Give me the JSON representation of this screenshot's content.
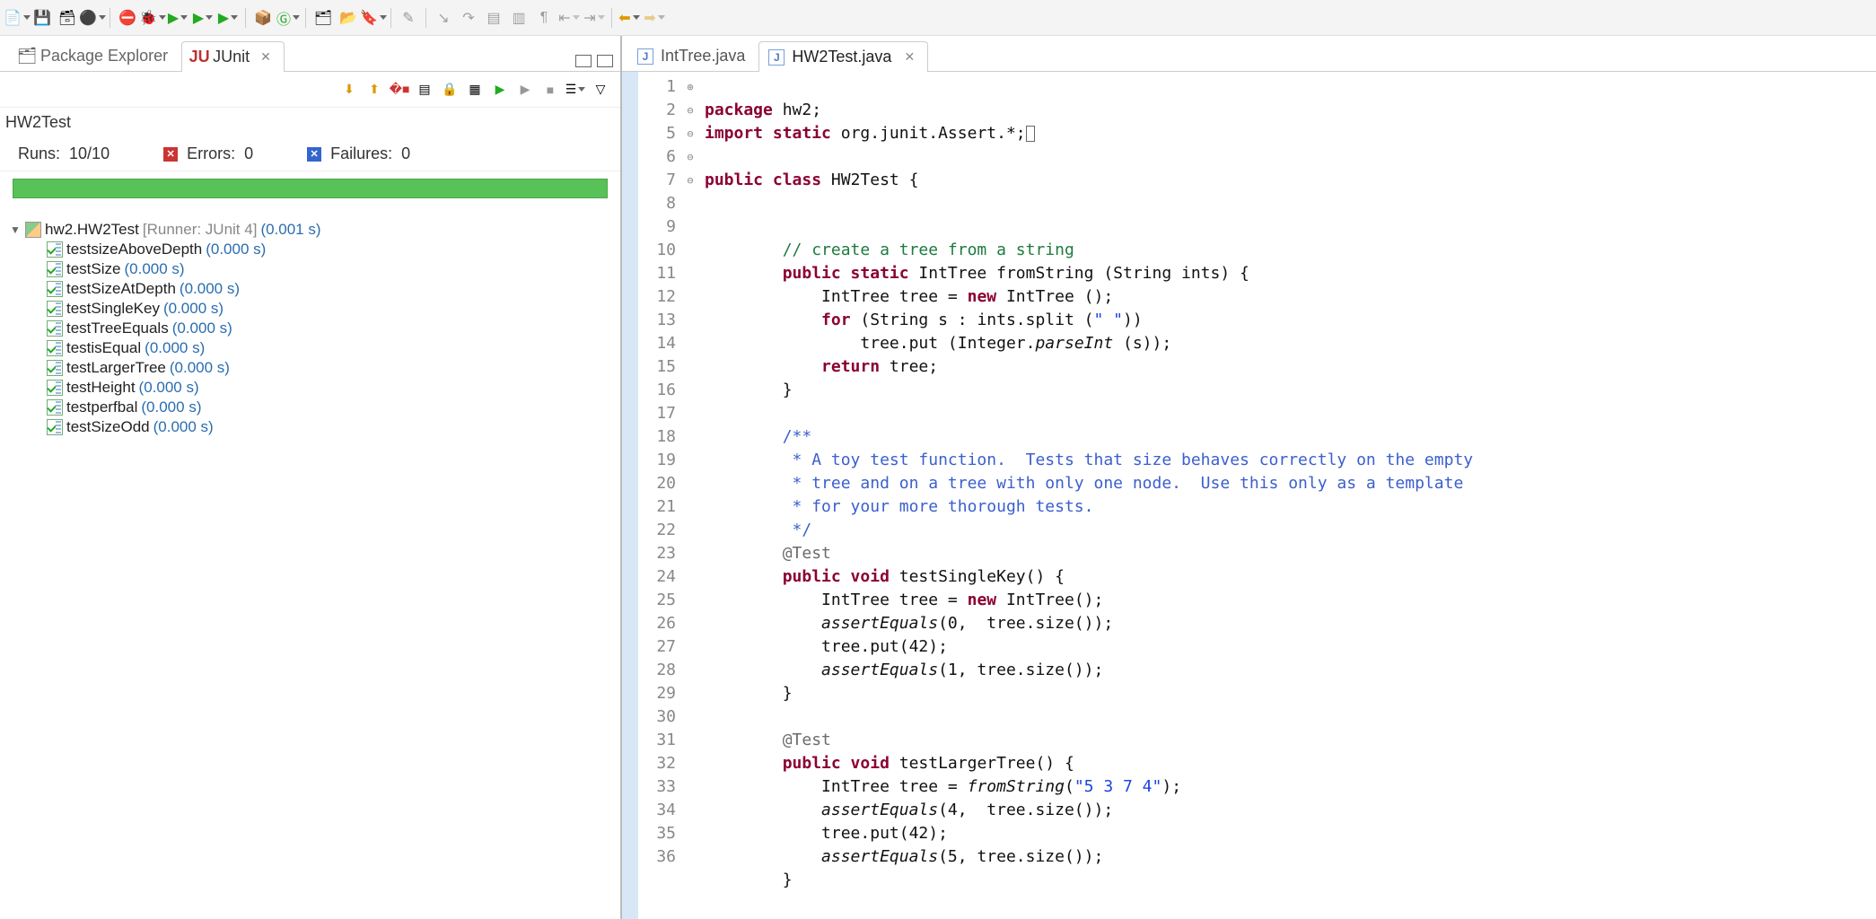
{
  "toolbar_icons": [
    "new",
    "save",
    "save-all",
    "user",
    "skip",
    "debug",
    "run-1",
    "run-2",
    "run-3",
    "package",
    "refresh",
    "browse",
    "open",
    "tag",
    "step",
    "s1",
    "s2",
    "s3",
    "s4",
    "s5",
    "s6",
    "s7",
    "s8",
    "s9",
    "back",
    "forward"
  ],
  "views": {
    "tab1": "Package Explorer",
    "tab2": "JUnit"
  },
  "junit": {
    "class_name": "HW2Test",
    "runs_label": "Runs:",
    "runs_value": "10/10",
    "errors_label": "Errors:",
    "errors_value": "0",
    "failures_label": "Failures:",
    "failures_value": "0",
    "suite_name": "hw2.HW2Test",
    "suite_runner": " [Runner: JUnit 4] ",
    "suite_time": "(0.001 s)",
    "tests": [
      {
        "name": "testsizeAboveDepth",
        "time": "(0.000 s)"
      },
      {
        "name": "testSize",
        "time": "(0.000 s)"
      },
      {
        "name": "testSizeAtDepth",
        "time": "(0.000 s)"
      },
      {
        "name": "testSingleKey",
        "time": "(0.000 s)"
      },
      {
        "name": "testTreeEquals",
        "time": "(0.000 s)"
      },
      {
        "name": "testisEqual",
        "time": "(0.000 s)"
      },
      {
        "name": "testLargerTree",
        "time": "(0.000 s)"
      },
      {
        "name": "testHeight",
        "time": "(0.000 s)"
      },
      {
        "name": "testperfbal",
        "time": "(0.000 s)"
      },
      {
        "name": "testSizeOdd",
        "time": "(0.000 s)"
      }
    ]
  },
  "editor": {
    "tab1": "IntTree.java",
    "tab2": "HW2Test.java",
    "line_numbers": [
      "1",
      "2",
      "5",
      "6",
      "7",
      "8",
      "9",
      "10",
      "11",
      "12",
      "13",
      "14",
      "15",
      "16",
      "17",
      "18",
      "19",
      "20",
      "21",
      "22",
      "23",
      "24",
      "25",
      "26",
      "27",
      "28",
      "29",
      "30",
      "31",
      "32",
      "33",
      "34",
      "35",
      "36"
    ],
    "fold_markers": [
      "",
      "⊕",
      "",
      "",
      "",
      "",
      "",
      "⊖",
      "",
      "",
      "",
      "",
      "",
      "",
      "⊖",
      "",
      "",
      "",
      "",
      "⊖",
      "",
      "",
      "",
      "",
      "",
      "",
      "",
      "⊖",
      "",
      "",
      "",
      "",
      "",
      ""
    ],
    "lines": {
      "l1a": "package",
      "l1b": " hw2;",
      "l2a": "import",
      "l2b": " static",
      "l2c": " org.junit.Assert.*;",
      "l6a": "public",
      "l6b": " class",
      "l6c": " HW2Test {",
      "l9": "        // create a tree from a string",
      "l10a": "        public",
      "l10b": " static",
      "l10c": " IntTree fromString (String ints) {",
      "l11a": "            IntTree tree = ",
      "l11b": "new",
      "l11c": " IntTree ();",
      "l12a": "            for",
      "l12b": " (String s : ints.split (",
      "l12c": "\" \"",
      "l12d": "))",
      "l13a": "                tree.put (Integer.",
      "l13b": "parseInt",
      "l13c": " (s));",
      "l14a": "            return",
      "l14b": " tree;",
      "l15": "        }",
      "l17": "        /**",
      "l18": "         * A toy test function.  Tests that size behaves correctly on the empty",
      "l19": "         * tree and on a tree with only one node.  Use this only as a template",
      "l20": "         * for your more thorough tests.",
      "l21": "         */",
      "l22": "        @Test",
      "l23a": "        public",
      "l23b": " void",
      "l23c": " testSingleKey() {",
      "l24a": "            IntTree tree = ",
      "l24b": "new",
      "l24c": " IntTree();",
      "l25a": "            assertEquals",
      "l25b": "(0,  tree.size());",
      "l26": "            tree.put(42);",
      "l27a": "            assertEquals",
      "l27b": "(1, tree.size());",
      "l28": "        }",
      "l30": "        @Test",
      "l31a": "        public",
      "l31b": " void",
      "l31c": " testLargerTree() {",
      "l32a": "            IntTree tree = ",
      "l32b": "fromString",
      "l32c": "(",
      "l32d": "\"5 3 7 4\"",
      "l32e": ");",
      "l33a": "            assertEquals",
      "l33b": "(4,  tree.size());",
      "l34": "            tree.put(42);",
      "l35a": "            assertEquals",
      "l35b": "(5, tree.size());",
      "l36": "        }"
    }
  }
}
